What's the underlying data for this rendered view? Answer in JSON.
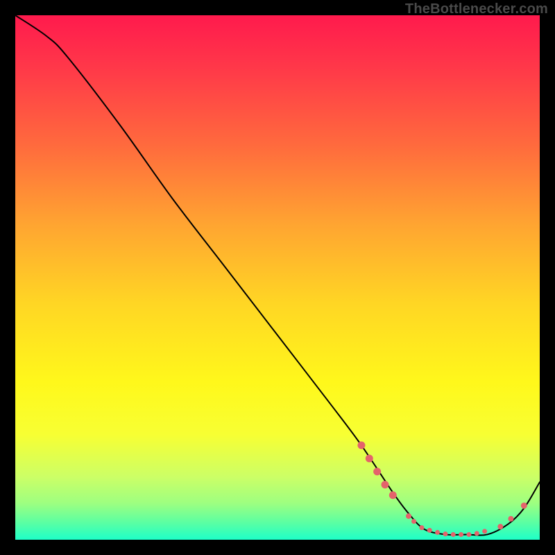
{
  "watermark": "TheBottlenecker.com",
  "chart_data": {
    "type": "line",
    "title": "",
    "xlabel": "",
    "ylabel": "",
    "xlim": [
      0,
      100
    ],
    "ylim": [
      0,
      100
    ],
    "background_gradient": {
      "stops": [
        {
          "t": 0.0,
          "color": "#ff1a4d"
        },
        {
          "t": 0.1,
          "color": "#ff3849"
        },
        {
          "t": 0.25,
          "color": "#ff6b3d"
        },
        {
          "t": 0.4,
          "color": "#ffa531"
        },
        {
          "t": 0.55,
          "color": "#ffd624"
        },
        {
          "t": 0.7,
          "color": "#fff81b"
        },
        {
          "t": 0.8,
          "color": "#f7ff33"
        },
        {
          "t": 0.88,
          "color": "#ccff66"
        },
        {
          "t": 0.93,
          "color": "#9eff80"
        },
        {
          "t": 0.965,
          "color": "#5fffa0"
        },
        {
          "t": 1.0,
          "color": "#1effc8"
        }
      ]
    },
    "curve": {
      "x": [
        0,
        6,
        10,
        20,
        30,
        40,
        50,
        60,
        66,
        72,
        75,
        78,
        82,
        86,
        90,
        94,
        97,
        100
      ],
      "y": [
        100,
        96,
        92,
        79,
        65,
        52,
        39,
        26,
        18,
        9,
        5,
        2,
        1,
        1,
        1,
        3,
        6,
        11
      ]
    },
    "markers": {
      "color": "#e4636b",
      "points": [
        {
          "x": 66.0,
          "y": 18.0,
          "r": 5.5
        },
        {
          "x": 67.5,
          "y": 15.5,
          "r": 5.5
        },
        {
          "x": 69.0,
          "y": 13.0,
          "r": 5.5
        },
        {
          "x": 70.5,
          "y": 10.5,
          "r": 5.5
        },
        {
          "x": 72.0,
          "y": 8.5,
          "r": 5.5
        },
        {
          "x": 75.0,
          "y": 4.5,
          "r": 4.0
        },
        {
          "x": 76.0,
          "y": 3.5,
          "r": 3.5
        },
        {
          "x": 77.5,
          "y": 2.3,
          "r": 3.5
        },
        {
          "x": 79.0,
          "y": 1.8,
          "r": 3.5
        },
        {
          "x": 80.5,
          "y": 1.4,
          "r": 3.5
        },
        {
          "x": 82.0,
          "y": 1.1,
          "r": 3.5
        },
        {
          "x": 83.5,
          "y": 1.0,
          "r": 3.5
        },
        {
          "x": 85.0,
          "y": 1.0,
          "r": 3.5
        },
        {
          "x": 86.5,
          "y": 1.0,
          "r": 3.5
        },
        {
          "x": 88.0,
          "y": 1.2,
          "r": 3.5
        },
        {
          "x": 89.5,
          "y": 1.6,
          "r": 3.5
        },
        {
          "x": 92.5,
          "y": 2.5,
          "r": 4.0
        },
        {
          "x": 94.5,
          "y": 4.0,
          "r": 4.0
        },
        {
          "x": 97.0,
          "y": 6.5,
          "r": 4.5
        }
      ]
    }
  }
}
